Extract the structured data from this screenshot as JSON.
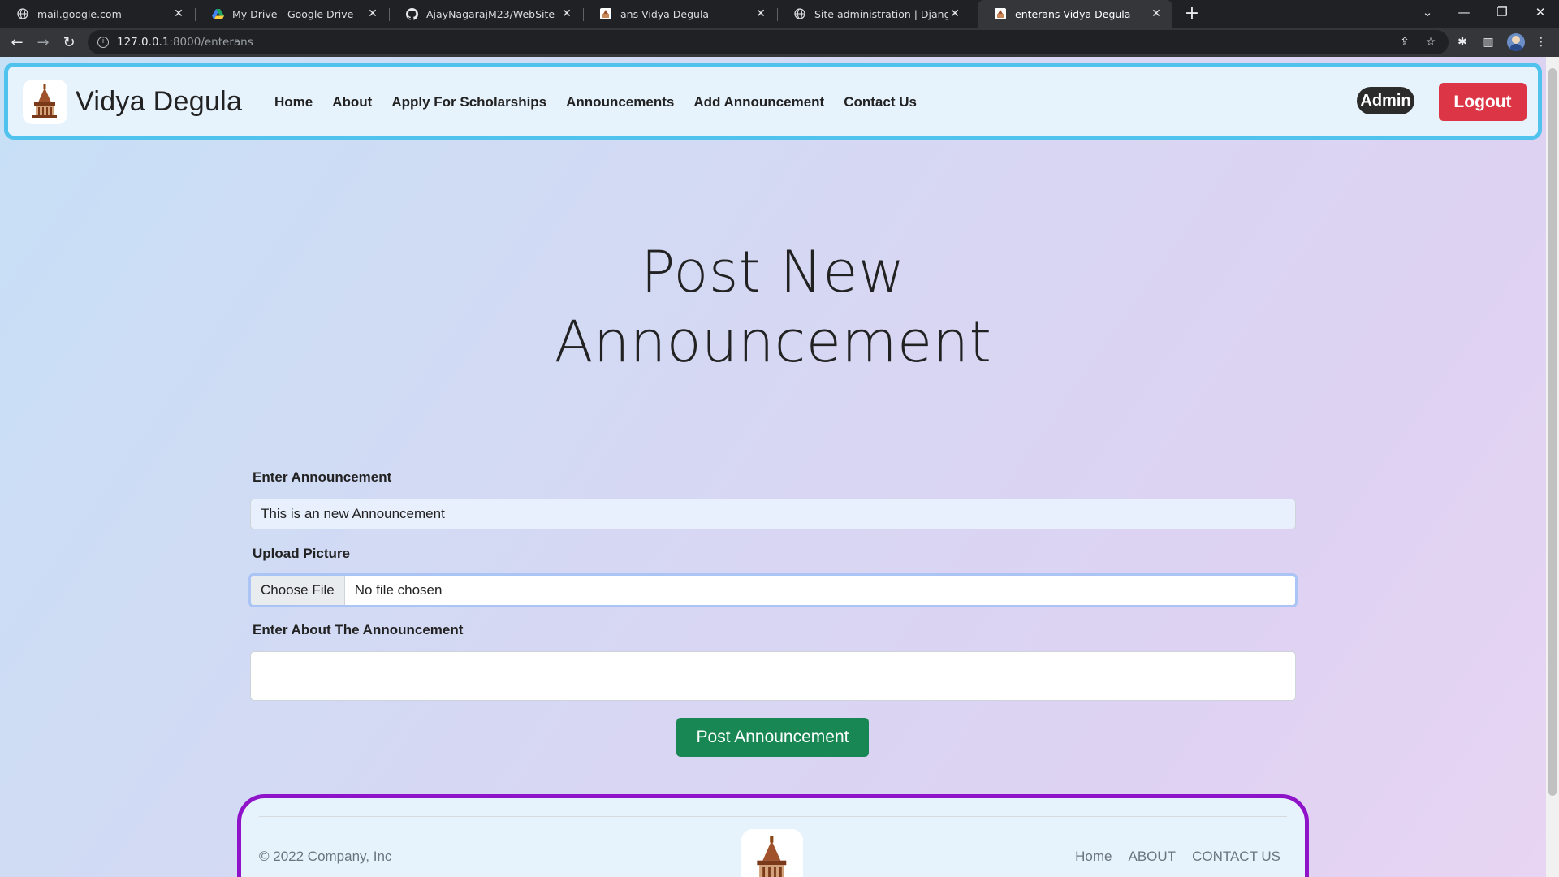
{
  "browser": {
    "tabs": [
      {
        "title": "mail.google.com",
        "icon": "globe-icon"
      },
      {
        "title": "My Drive - Google Drive",
        "icon": "google-drive-icon"
      },
      {
        "title": "AjayNagarajM23/WebSite",
        "icon": "github-icon"
      },
      {
        "title": "ans Vidya Degula",
        "icon": "site-favicon"
      },
      {
        "title": "Site administration | Django site admin",
        "icon": "globe-icon"
      },
      {
        "title": "enterans Vidya Degula",
        "icon": "site-favicon",
        "active": true
      }
    ],
    "url_host": "127.0.0.1",
    "url_path": ":8000/enterans"
  },
  "navbar": {
    "brand": "Vidya Degula",
    "links": [
      "Home",
      "About",
      "Apply For Scholarships",
      "Announcements",
      "Add Announcement",
      "Contact Us"
    ],
    "admin_label": "Admin",
    "logout_label": "Logout"
  },
  "page": {
    "heading_line1": "Post New",
    "heading_line2": "Announcement"
  },
  "form": {
    "announcement_label": "Enter Announcement",
    "announcement_value": "This is an new Announcement",
    "picture_label": "Upload Picture",
    "file_button": "Choose File",
    "file_status": "No file chosen",
    "about_label": "Enter About The Announcement",
    "about_value": "",
    "submit_label": "Post Announcement"
  },
  "footer": {
    "copyright": "© 2022 Company, Inc",
    "links": [
      "Home",
      "ABOUT",
      "CONTACT US"
    ]
  },
  "colors": {
    "nav_border": "#4fc3ee",
    "footer_border": "#8e13c9",
    "logout": "#dc3545",
    "submit": "#198754"
  }
}
